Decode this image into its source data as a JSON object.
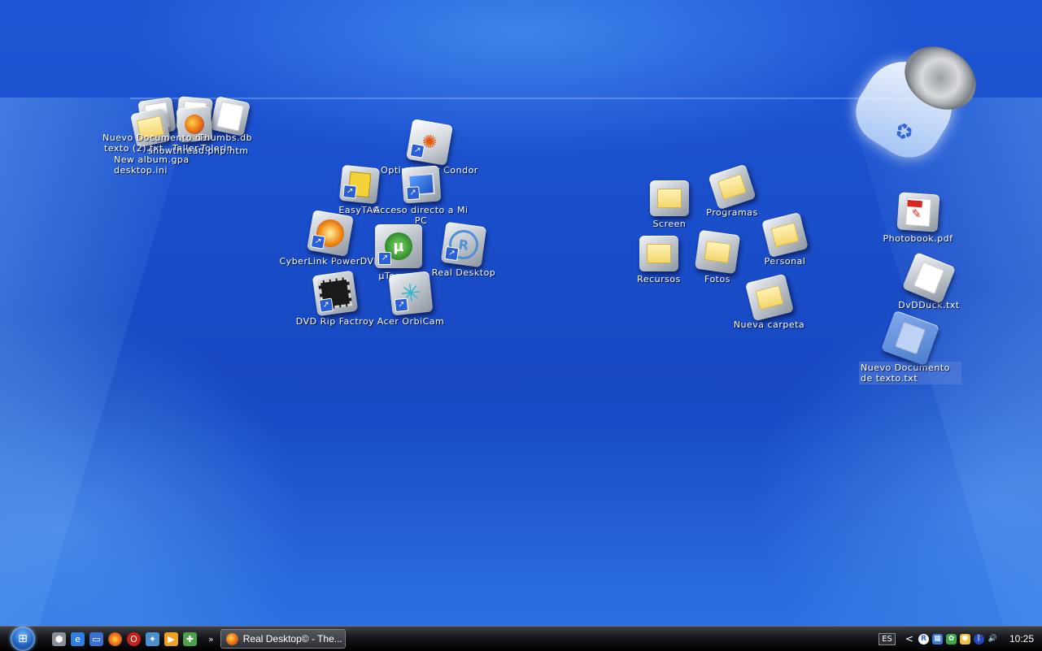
{
  "desktop": {
    "cluster_labels": [
      "Nuevo Documento de",
      "texto (2).txt",
      "Thumbs.db",
      "Taller-Tolerin",
      "showthread.php.htm",
      "New album.gpa",
      "desktop.ini"
    ],
    "icons_left": {
      "optimizador": "Optimizador Condor 3.0",
      "easytag": "EasyTAG",
      "mi_pc": "Acceso directo a Mi PC",
      "powerdvd": "CyberLink PowerDVD",
      "utorrent": "µTorrent",
      "real_desktop": "Real Desktop",
      "dvd_rip": "DVD Rip Factroy",
      "orbicam": "Acer OrbiCam"
    },
    "folders": {
      "screen": "Screen",
      "programas": "Programas",
      "personal": "Personal",
      "recursos": "Recursos",
      "fotos": "Fotos",
      "nueva_carpeta": "Nueva carpeta"
    },
    "files_right": {
      "photobook": "Photobook.pdf",
      "dvdduck": "DvDDuck.txt",
      "nuevo_doc": "Nuevo Documento de texto.txt"
    }
  },
  "taskbar": {
    "chevrons": "»",
    "task_label": "Real Desktop© - The...",
    "language": "ES",
    "tray_arrow": "<",
    "clock": "10:25"
  },
  "colors": {
    "desktop_blue": "#1b4fcc",
    "taskbar_black": "#15171b",
    "folder_yellow": "#f2d468"
  }
}
